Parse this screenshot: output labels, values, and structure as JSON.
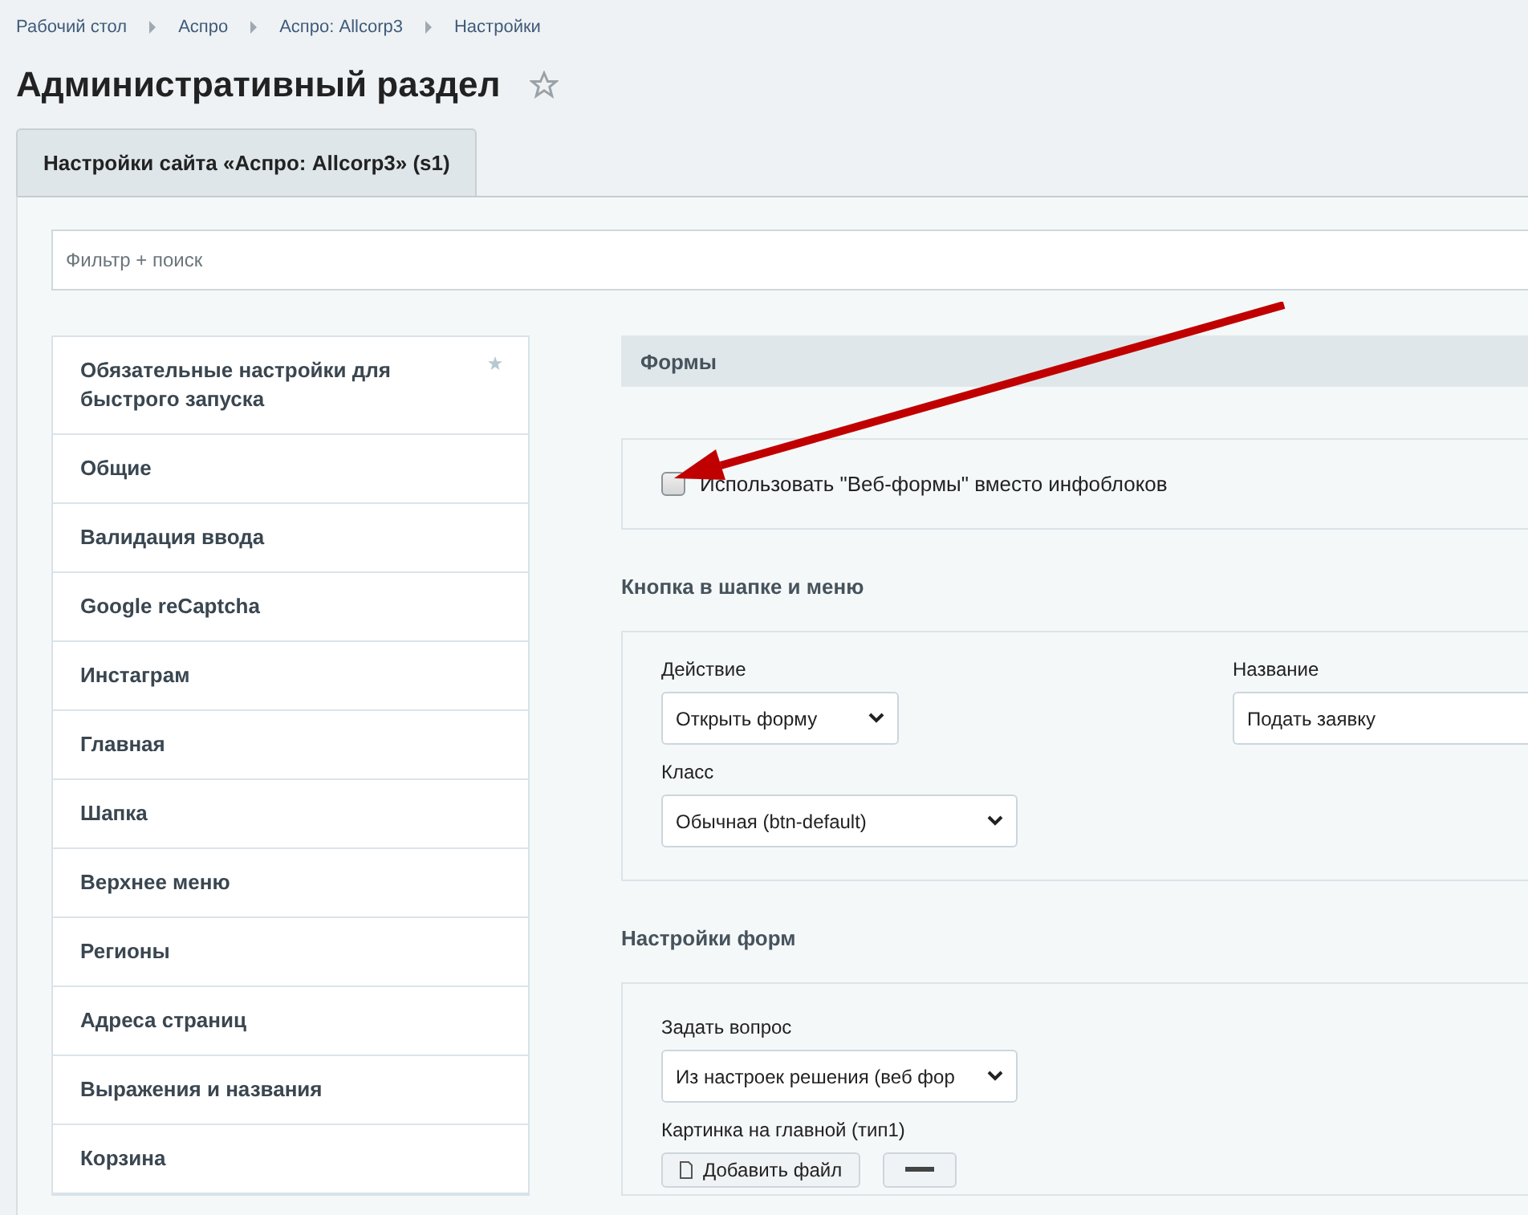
{
  "breadcrumbs": [
    "Рабочий стол",
    "Аспро",
    "Аспро: Allcorp3",
    "Настройки"
  ],
  "page_title": "Административный раздел",
  "favorite": false,
  "tabs": [
    {
      "label": "Настройки сайта «Аспро: Allcorp3» (s1)",
      "selected": true
    }
  ],
  "filter": {
    "placeholder": "Фильтр + поиск"
  },
  "sidebar": {
    "items": [
      {
        "label": "Обязательные настройки для быстрого запуска",
        "starred": true
      },
      {
        "label": "Общие",
        "starred": false
      },
      {
        "label": "Валидация ввода",
        "starred": false
      },
      {
        "label": "Google reCaptcha",
        "starred": false
      },
      {
        "label": "Инстаграм",
        "starred": false
      },
      {
        "label": "Главная",
        "starred": false
      },
      {
        "label": "Шапка",
        "starred": false
      },
      {
        "label": "Верхнее меню",
        "starred": false
      },
      {
        "label": "Регионы",
        "starred": false
      },
      {
        "label": "Адреса страниц",
        "starred": false
      },
      {
        "label": "Выражения и названия",
        "starred": false
      },
      {
        "label": "Корзина",
        "starred": false
      }
    ]
  },
  "section_title": "Формы",
  "webforms_option": {
    "label": "Использовать \"Веб-формы\" вместо инфоблоков",
    "checked": false
  },
  "groups": [
    {
      "title": "Кнопка в шапке и меню",
      "fields": [
        {
          "kind": "select",
          "label": "Действие",
          "value": "Открыть форму"
        },
        {
          "kind": "text",
          "label": "Название",
          "value": "Подать заявку"
        },
        {
          "kind": "select",
          "label": "Класс",
          "value": "Обычная (btn-default)"
        }
      ]
    },
    {
      "title": "Настройки форм",
      "fields": [
        {
          "kind": "select",
          "label": "Задать вопрос",
          "value": "Из настроек решения (веб фор"
        },
        {
          "kind": "file",
          "label": "Картинка на главной (тип1)",
          "value": "Добавить файл"
        }
      ]
    }
  ]
}
